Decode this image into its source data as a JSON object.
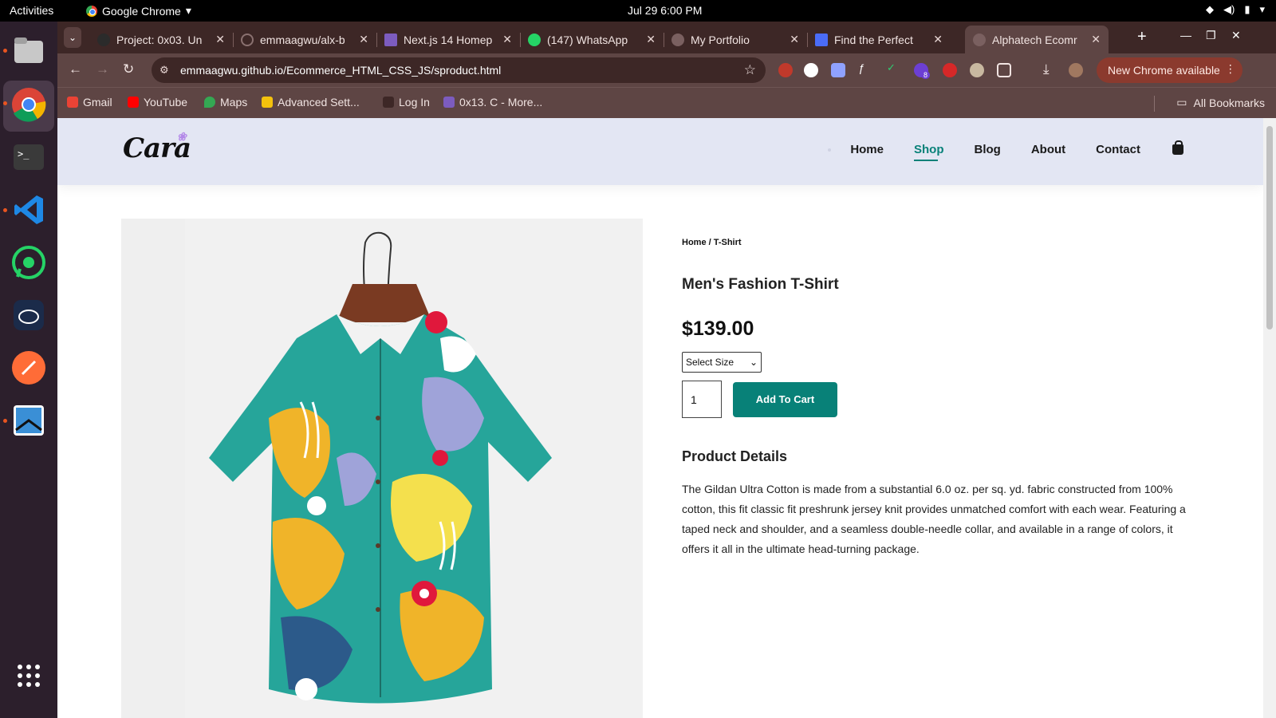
{
  "os": {
    "activities": "Activities",
    "app_name": "Google Chrome",
    "app_caret": "▾",
    "clock": "Jul 29  6:00 PM"
  },
  "browser": {
    "tabs": [
      {
        "title": "Project: 0x03. Un"
      },
      {
        "title": "emmaagwu/alx-b"
      },
      {
        "title": "Next.js 14 Homep"
      },
      {
        "title": "(147) WhatsApp"
      },
      {
        "title": "My Portfolio"
      },
      {
        "title": "Find the Perfect"
      },
      {
        "title": "Alphatech Ecomr"
      }
    ],
    "url": "emmaagwu.github.io/Ecommerce_HTML_CSS_JS/sproduct.html",
    "update_label": "New Chrome available",
    "bookmarks": [
      "Gmail",
      "YouTube",
      "Maps",
      "Advanced Sett...",
      "Log In",
      "0x13. C - More..."
    ],
    "all_bookmarks": "All Bookmarks",
    "extension_badge": "8"
  },
  "site": {
    "logo": "Cara",
    "nav": [
      "Home",
      "Shop",
      "Blog",
      "About",
      "Contact"
    ],
    "active_nav": "Shop"
  },
  "product": {
    "breadcrumb": "Home / T-Shirt",
    "title": "Men's Fashion T-Shirt",
    "price": "$139.00",
    "size_placeholder": "Select Size",
    "quantity": "1",
    "add_to_cart": "Add To Cart",
    "details_heading": "Product Details",
    "details_text": "The Gildan Ultra Cotton is made from a substantial 6.0 oz. per sq. yd. fabric constructed from 100% cotton, this fit classic fit preshrunk jersey knit provides unmatched comfort with each wear. Featuring a taped neck and shoulder, and a seamless double-needle collar, and available in a range of colors, it offers it all in the ultimate head-turning package."
  },
  "colors": {
    "accent": "#088178",
    "header_bg": "#e3e6f3",
    "chrome_frame": "#3d2726"
  }
}
